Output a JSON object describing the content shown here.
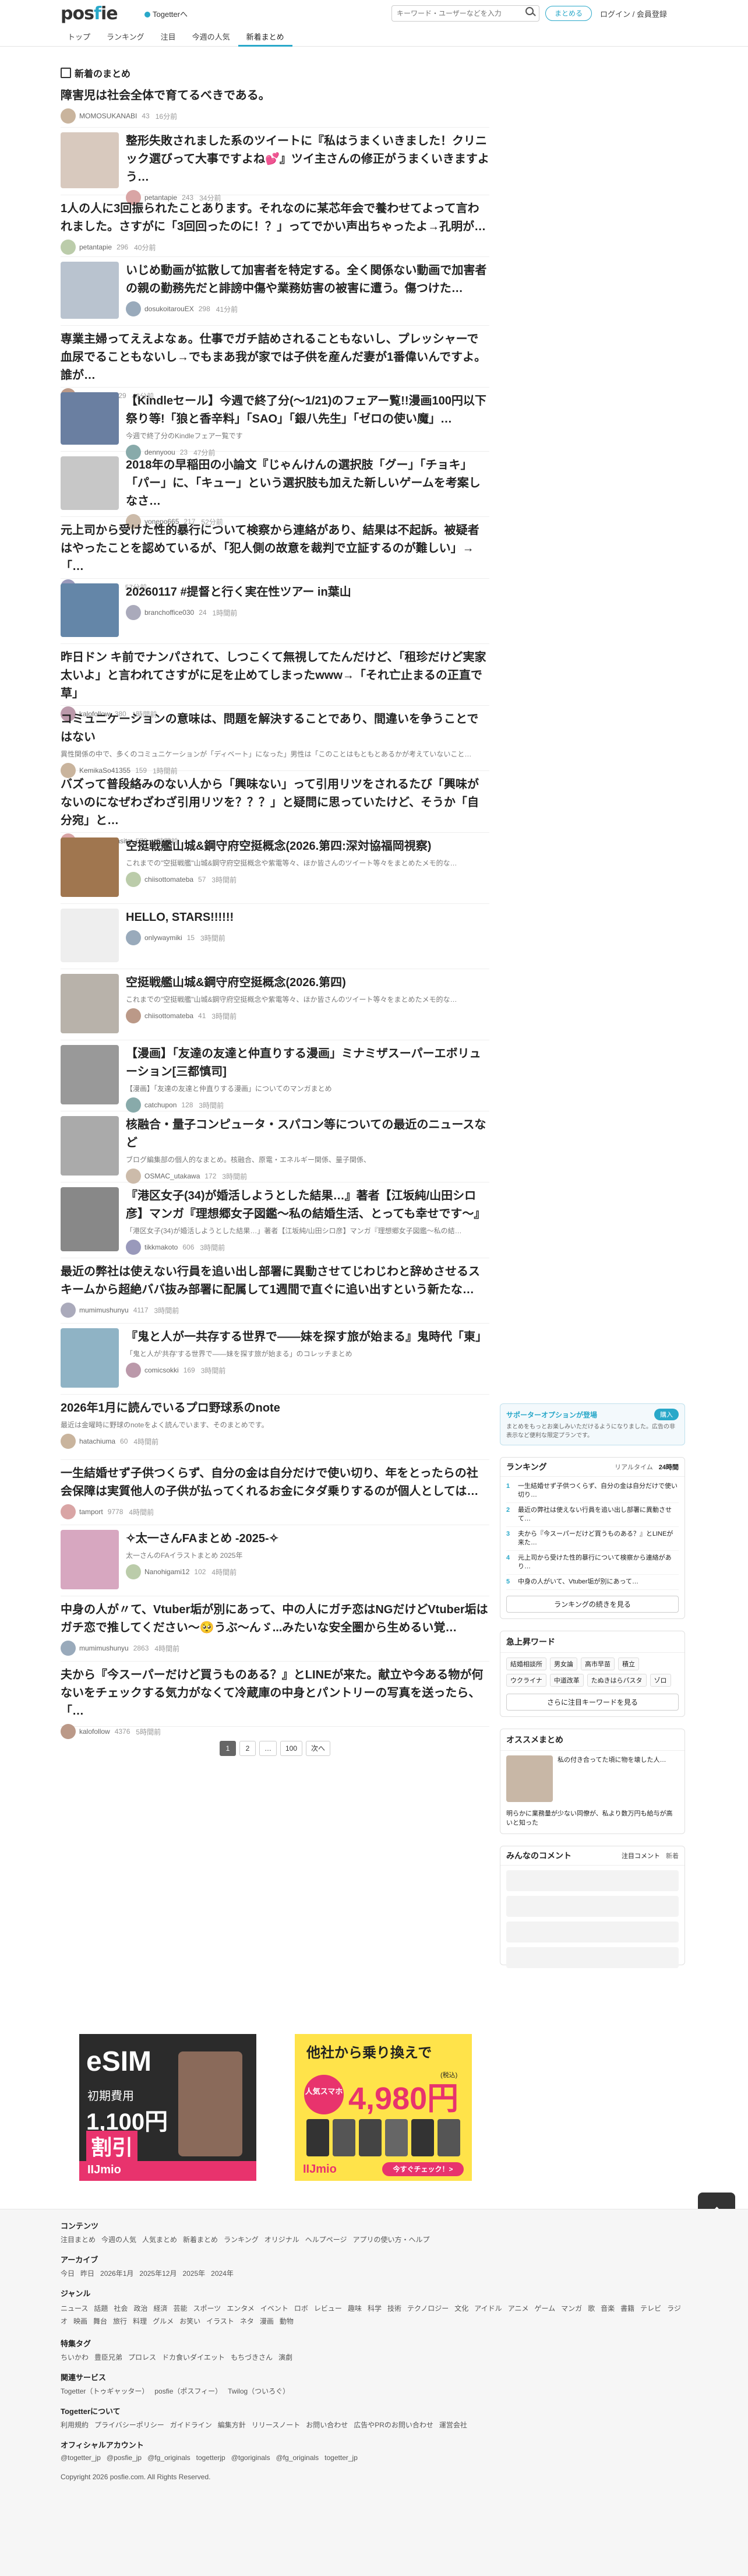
{
  "header": {
    "logo": "posfie",
    "togetter_link": "Togetterへ",
    "search_placeholder": "キーワード・ユーザーなどを入力",
    "create_button": "まとめる",
    "login": "ログイン / 会員登録"
  },
  "nav": [
    {
      "label": "トップ"
    },
    {
      "label": "ランキング"
    },
    {
      "label": "注目"
    },
    {
      "label": "今週の人気"
    },
    {
      "label": "新着まとめ"
    }
  ],
  "main": {
    "section_title": "新着のまとめ",
    "items": [
      {
        "title": "障害児は社会全体で育てるべきである。",
        "user": "MOMOSUKANABI",
        "count": "43",
        "time": "16分前"
      },
      {
        "title": "整形失敗されました系のツイートに『私はうまくいきました！クリニック選びって大事ですよね💕』ツイ主さんの修正がうまくいきますよう…",
        "user": "petantapie",
        "count": "243",
        "time": "34分前"
      },
      {
        "title": "1人の人に3回振られたことあります。それなのに某芯年会で養わせてよって言われました。さすがに「3回回ったのに！？」ってでかい声出ちゃったよ→孔明が…",
        "user": "petantapie",
        "count": "296",
        "time": "40分前"
      },
      {
        "title": "いじめ動画が拡散して加害者を特定する。全く関係ない動画で加害者の親の勤務先だと誹謗中傷や業務妨害の被害に遭う。傷つけた…",
        "user": "dosukoitarouEX",
        "count": "298",
        "time": "41分前"
      },
      {
        "title": "専業主婦ってええよなぁ。仕事でガチ詰めされることもないし、プレッシャーで血尿でることもないし→でもまあ我が家では子供を産んだ妻が1番偉いんですよ。誰が…",
        "user": "kalofollow",
        "count": "329",
        "time": "46分前"
      },
      {
        "title": "【Kindleセール】今週で終了分(〜1/21)のフェアー覧!!漫画100円以下祭り等!「狼と香辛料」「SAO」「銀八先生」「ゼロの使い魔」…",
        "desc": "今週で終了分のKindleフェアー覧です",
        "user": "dennyoou",
        "count": "23",
        "time": "47分前"
      },
      {
        "title": "2018年の早稲田の小論文『じゃんけんの選択肢「グー」「チョキ」「パー」に、「キュー」という選択肢も加えた新しいゲームを考案しなさ…",
        "user": "yonepo665",
        "count": "217",
        "time": "52分前"
      },
      {
        "title": "元上司から受けた性的暴行について検察から連絡があり、結果は不起訴。被疑者はやったことを認めているが、「犯人側の故意を裁判で立証するのが難しい」→「…",
        "user": "tamport",
        "count": "464",
        "time": "57分前"
      },
      {
        "title": "20260117 #提督と行く実在性ツアー in葉山",
        "user": "branchoffice030",
        "count": "24",
        "time": "1時間前"
      },
      {
        "title": "昨日ドン キ前でナンパされて、しつこくて無視してたんだけど、「租珍だけど実家太いよ」と言われてさすがに足を止めてしまったwww→「それ亡止まるの正直で草」",
        "user": "kalofollow",
        "count": "380",
        "time": "1時間前"
      },
      {
        "title": "コミュニケーションの意味は、問題を解決することであり、間違いを争うことではない",
        "desc": "異性関係の中で、多くのコミュニケーションが「ディベート」になった」男性は「このことはもともとあるかが考えていないこと…",
        "user": "KemikaSo41355",
        "count": "159",
        "time": "1時間前"
      },
      {
        "title": "バズって普段絡みのない人から「興味ない」って引用リツをされるたび「興味がないのになぜわざわざ引用リツを？？？」と疑問に思っていたけど、そうか「自分宛」と…",
        "user": "kekkonshimasita",
        "count": "570",
        "time": "1時間前"
      },
      {
        "title": "空挺戦艦山城&鋼守府空挺概念(2026.第四:深対協福岡視察)",
        "desc": "これまでの\"空挺戦艦\"山城&鋼守府空挺概念や紫電等々、ほか皆さんのツイート等々をまとめたメモ的な…",
        "user": "chiisottomateba",
        "count": "57",
        "time": "3時間前"
      },
      {
        "title": "HELLO, STARS!!!!!!",
        "user": "onlywaymiki",
        "count": "15",
        "time": "3時間前"
      },
      {
        "title": "空挺戦艦山城&鋼守府空挺概念(2026.第四)",
        "desc": "これまでの\"空挺戦艦\"山城&鋼守府空挺概念や紫電等々、ほか皆さんのツイート等々をまとめたメモ的な…",
        "user": "chiisottomateba",
        "count": "41",
        "time": "3時間前"
      },
      {
        "title": "【漫画】「友達の友達と仲直りする漫画」ミナミザスーパーエボリューション[三都慎司]",
        "desc": "【漫画】「友達の友達と仲直りする漫画」についてのマンガまとめ",
        "user": "catchupon",
        "count": "128",
        "time": "3時間前"
      },
      {
        "title": "核融合・量子コンピュータ・スパコン等についての最近のニュースなど",
        "desc": "ブログ編集部の個人的なまとめ。核融合、原電・エネルギー関係、量子関係、",
        "user": "OSMAC_utakawa",
        "count": "172",
        "time": "3時間前"
      },
      {
        "title": "『港区女子(34)が婚活しようとした結果…』著者【江坂純/山田シロ彦】マンガ『理想郷女子図鑑〜私の結婚生活、とっても幸せです〜』",
        "desc": "「港区女子(34)が婚活しようとした結果…」著者【江坂純/山田シロ彦】マンガ『理想郷女子図鑑〜私の結…",
        "user": "tikkmakoto",
        "count": "606",
        "time": "3時間前"
      },
      {
        "title": "最近の弊社は使えない行員を追い出し部署に異動させてじわじわと辞めさせるスキームから超絶ババ抜み部署に配属して1週間で直ぐに追い出すという新たな…",
        "user": "mumimushunyu",
        "count": "4117",
        "time": "3時間前"
      },
      {
        "title": "『鬼と人が一共存する世界で——妹を探す旅が始まる』鬼時代「東」",
        "desc": "「鬼と人が'共存'する世界で——妹を探す旅が始まる」のコレッチまとめ",
        "user": "comicsokki",
        "count": "169",
        "time": "3時間前"
      },
      {
        "title": "2026年1月に読んでいるプロ野球系のnote",
        "desc": "最近は金曜時に野球のnoteをよく読んでいます、そのまとめです。",
        "user": "hatachiuma",
        "count": "60",
        "time": "4時間前"
      },
      {
        "title": "一生結婚せず子供つくらず、自分の金は自分だけで使い切り、年をとったらの社会保障は実質他人の子供が払ってくれるお金にタダ乗りするのが個人としては…",
        "user": "tamport",
        "count": "9778",
        "time": "4時間前"
      },
      {
        "title": "✧太一さんFAまとめ -2025-✧",
        "desc": "太一さんのFAイラストまとめ 2025年",
        "user": "Nanohigami12",
        "count": "102",
        "time": "4時間前"
      },
      {
        "title": "中身の人が〃て、Vtuber垢が別にあって、中の人にガチ恋はNGだけどVtuber垢はガチ恋で推してください〜🥺うぶ〜んゞ...みたいな安全圏から生めるい覚…",
        "user": "mumimushunyu",
        "count": "2863",
        "time": "4時間前"
      },
      {
        "title": "夫から『今スーパーだけど買うものある？』とLINEが来た。献立や今ある物が何ないをチェックする気力がなくて冷蔵庫の中身とパントリーの写真を送ったら、「…",
        "user": "kalofollow",
        "count": "4376",
        "time": "5時間前"
      }
    ],
    "pagination": [
      "1",
      "2",
      "…",
      "100",
      "次へ"
    ]
  },
  "ads": {
    "ad1": {
      "title": "eSIM",
      "sub": "初期費用",
      "price": "1,100円",
      "tag": "割引",
      "brand": "IIJmio"
    },
    "ad2": {
      "lead": "他社から乗り換えで",
      "price": "4,980円",
      "tax": "(税込)",
      "badge": "人気スマホ",
      "brand": "IIJmio",
      "cta": "今すぐチェック！>"
    }
  },
  "sidebar": {
    "support": {
      "title": "サポーターオプションが登場",
      "button": "購入",
      "text": "まとめをもっとお楽しみいただけるようになりました。広告の非表示など便利な限定プランです。"
    },
    "ranking": {
      "title": "ランキング",
      "tabs": [
        "リアルタイム",
        "24時間"
      ],
      "items": [
        "一生結婚せず子供つくらず、自分の金は自分だけで使い切り…",
        "最近の弊社は使えない行員を追い出し部署に異動させて…",
        "夫から『今スーパーだけど買うものある？』とLINEが来た…",
        "元上司から受けた性的暴行について検察から連絡があり…",
        "中身の人がいて、Vtuber垢が別にあって…"
      ],
      "more": "ランキングの続きを見る"
    },
    "keywords": {
      "title": "急上昇ワード",
      "items": [
        "結婚相談所",
        "男女論",
        "高市早苗",
        "積立",
        "ウクライナ",
        "中道改革",
        "たぬきはらパスタ",
        "ゾロ"
      ],
      "more": "さらに注目キーワードを見る"
    },
    "recommend": {
      "title": "オススメまとめ",
      "text": "私の付き合ってた頃に物を壊した人…",
      "text2": "明らかに業務量が少ない同僚が、私より数万円も給与が高いと知った"
    },
    "comments": {
      "title": "みんなのコメント",
      "tabs": [
        "注目コメント",
        "新着"
      ]
    }
  },
  "footer": {
    "contents_title": "コンテンツ",
    "contents": [
      "注目まとめ",
      "今週の人気",
      "人気まとめ",
      "新着まとめ",
      "ランキング",
      "オリジナル",
      "ヘルプページ",
      "アプリの使い方・ヘルプ"
    ],
    "archive_title": "アーカイブ",
    "archive": [
      "今日",
      "昨日",
      "2026年1月",
      "2025年12月",
      "2025年",
      "2024年"
    ],
    "genre_title": "ジャンル",
    "genre": [
      "ニュース",
      "話題",
      "社会",
      "政治",
      "経済",
      "芸能",
      "スポーツ",
      "エンタメ",
      "イベント",
      "ロボ",
      "レビュー",
      "趣味",
      "科学",
      "技術",
      "テクノロジー",
      "文化",
      "アイドル",
      "アニメ",
      "ゲーム",
      "マンガ",
      "歌",
      "音楽",
      "書籍",
      "テレビ",
      "ラジオ",
      "映画",
      "舞台",
      "旅行",
      "料理",
      "グルメ",
      "お笑い",
      "イラスト",
      "ネタ",
      "漫画",
      "動物"
    ],
    "special_title": "特集タグ",
    "special": [
      "ちいかわ",
      "豊臣兄弟",
      "プロレス",
      "ドカ食いダイエット",
      "もちづきさん",
      "演劇"
    ],
    "related_title": "関連サービス",
    "related": [
      "Togetter（トゥギャッター）",
      "posfie（ポスフィー）",
      "Twilog（ついろぐ）"
    ],
    "about_title": "Togetterについて",
    "about": [
      "利用規約",
      "プライバシーポリシー",
      "ガイドライン",
      "編集方針",
      "リリースノート",
      "お問い合わせ",
      "広告やPRのお問い合わせ",
      "運営会社"
    ],
    "official_title": "オフィシャルアカウント",
    "official": [
      "@togetter_jp",
      "@posfie_jp",
      "@fg_originals",
      "togetterjp",
      "@tgoriginals",
      "@fg_originals",
      "togetter_jp"
    ],
    "copyright": "Copyright 2026 posfie.com. All Rights Reserved."
  }
}
